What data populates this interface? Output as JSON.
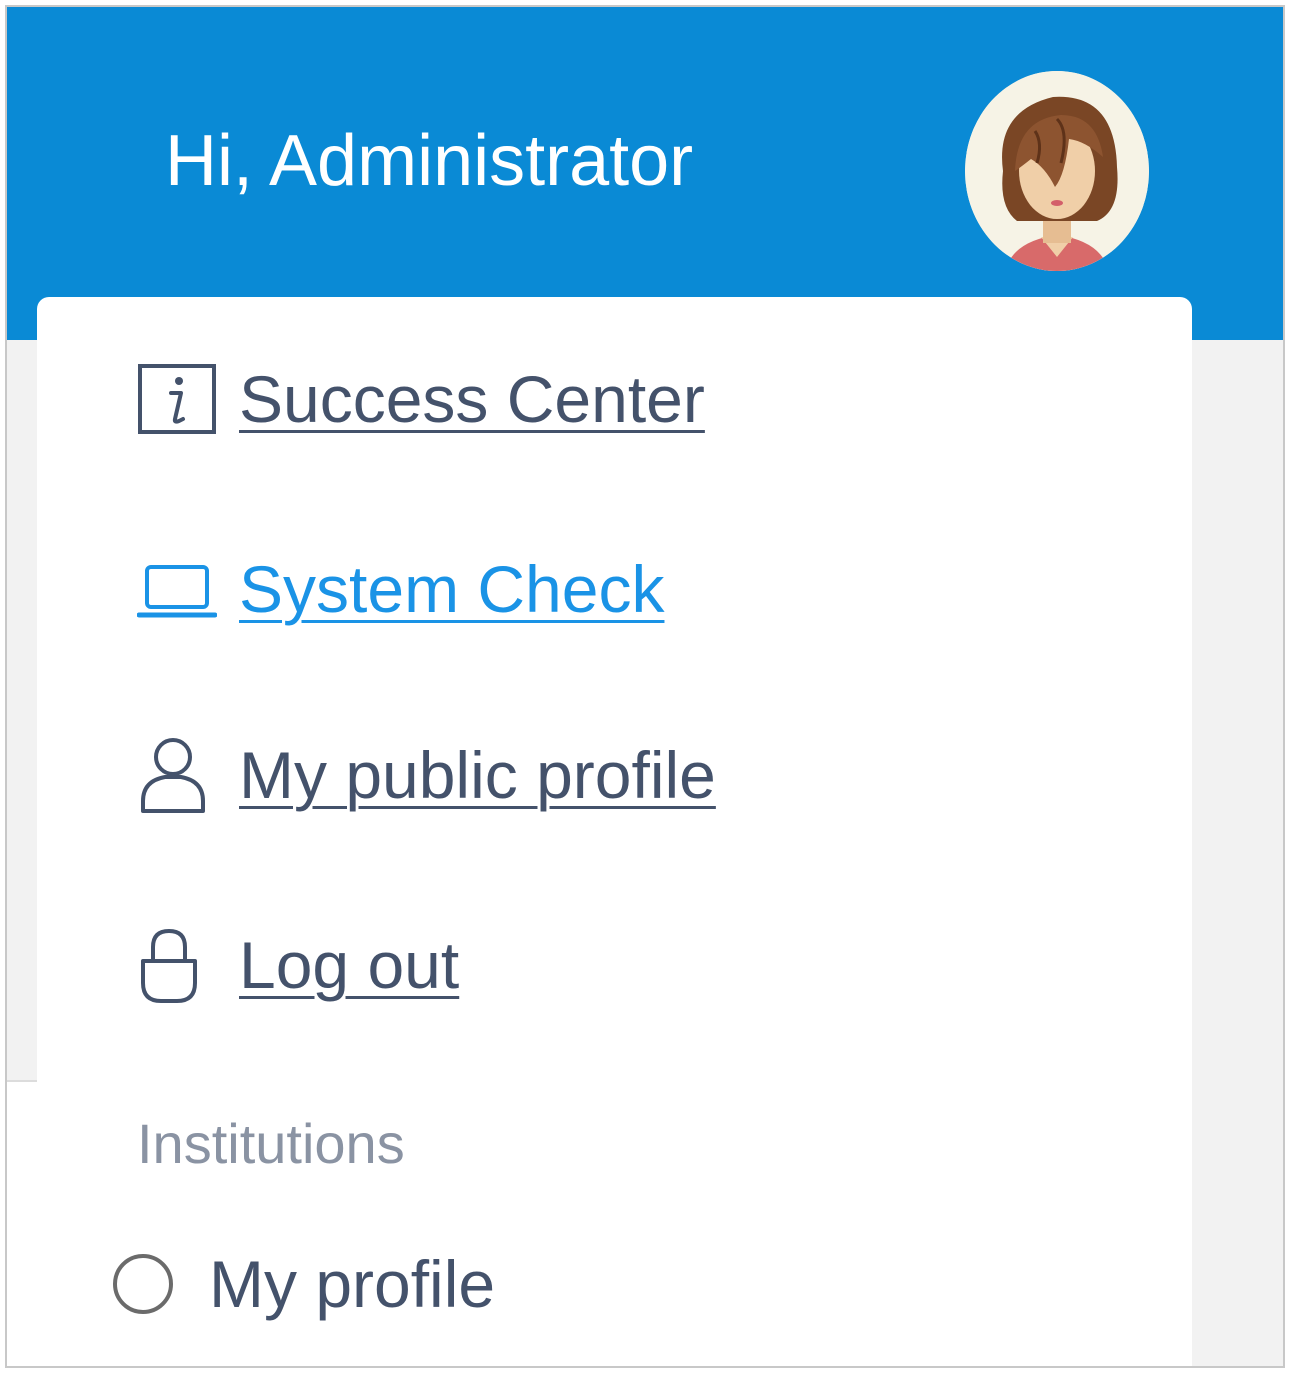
{
  "header": {
    "greeting": "Hi, Administrator",
    "background_color": "#0a8ad5",
    "avatar_icon": "user-avatar-icon"
  },
  "menu": {
    "items": [
      {
        "label": "Success Center",
        "icon": "info-icon",
        "color": "#44526b"
      },
      {
        "label": " System Check",
        "icon": "laptop-icon",
        "color": "#1a93e6"
      },
      {
        "label": "My public profile",
        "icon": "user-icon",
        "color": "#44526b"
      },
      {
        "label": "Log out",
        "icon": "lock-icon",
        "color": "#44526b"
      }
    ]
  },
  "institutions": {
    "section_title": "Institutions",
    "options": [
      {
        "label": "My profile",
        "selected": false
      }
    ]
  }
}
